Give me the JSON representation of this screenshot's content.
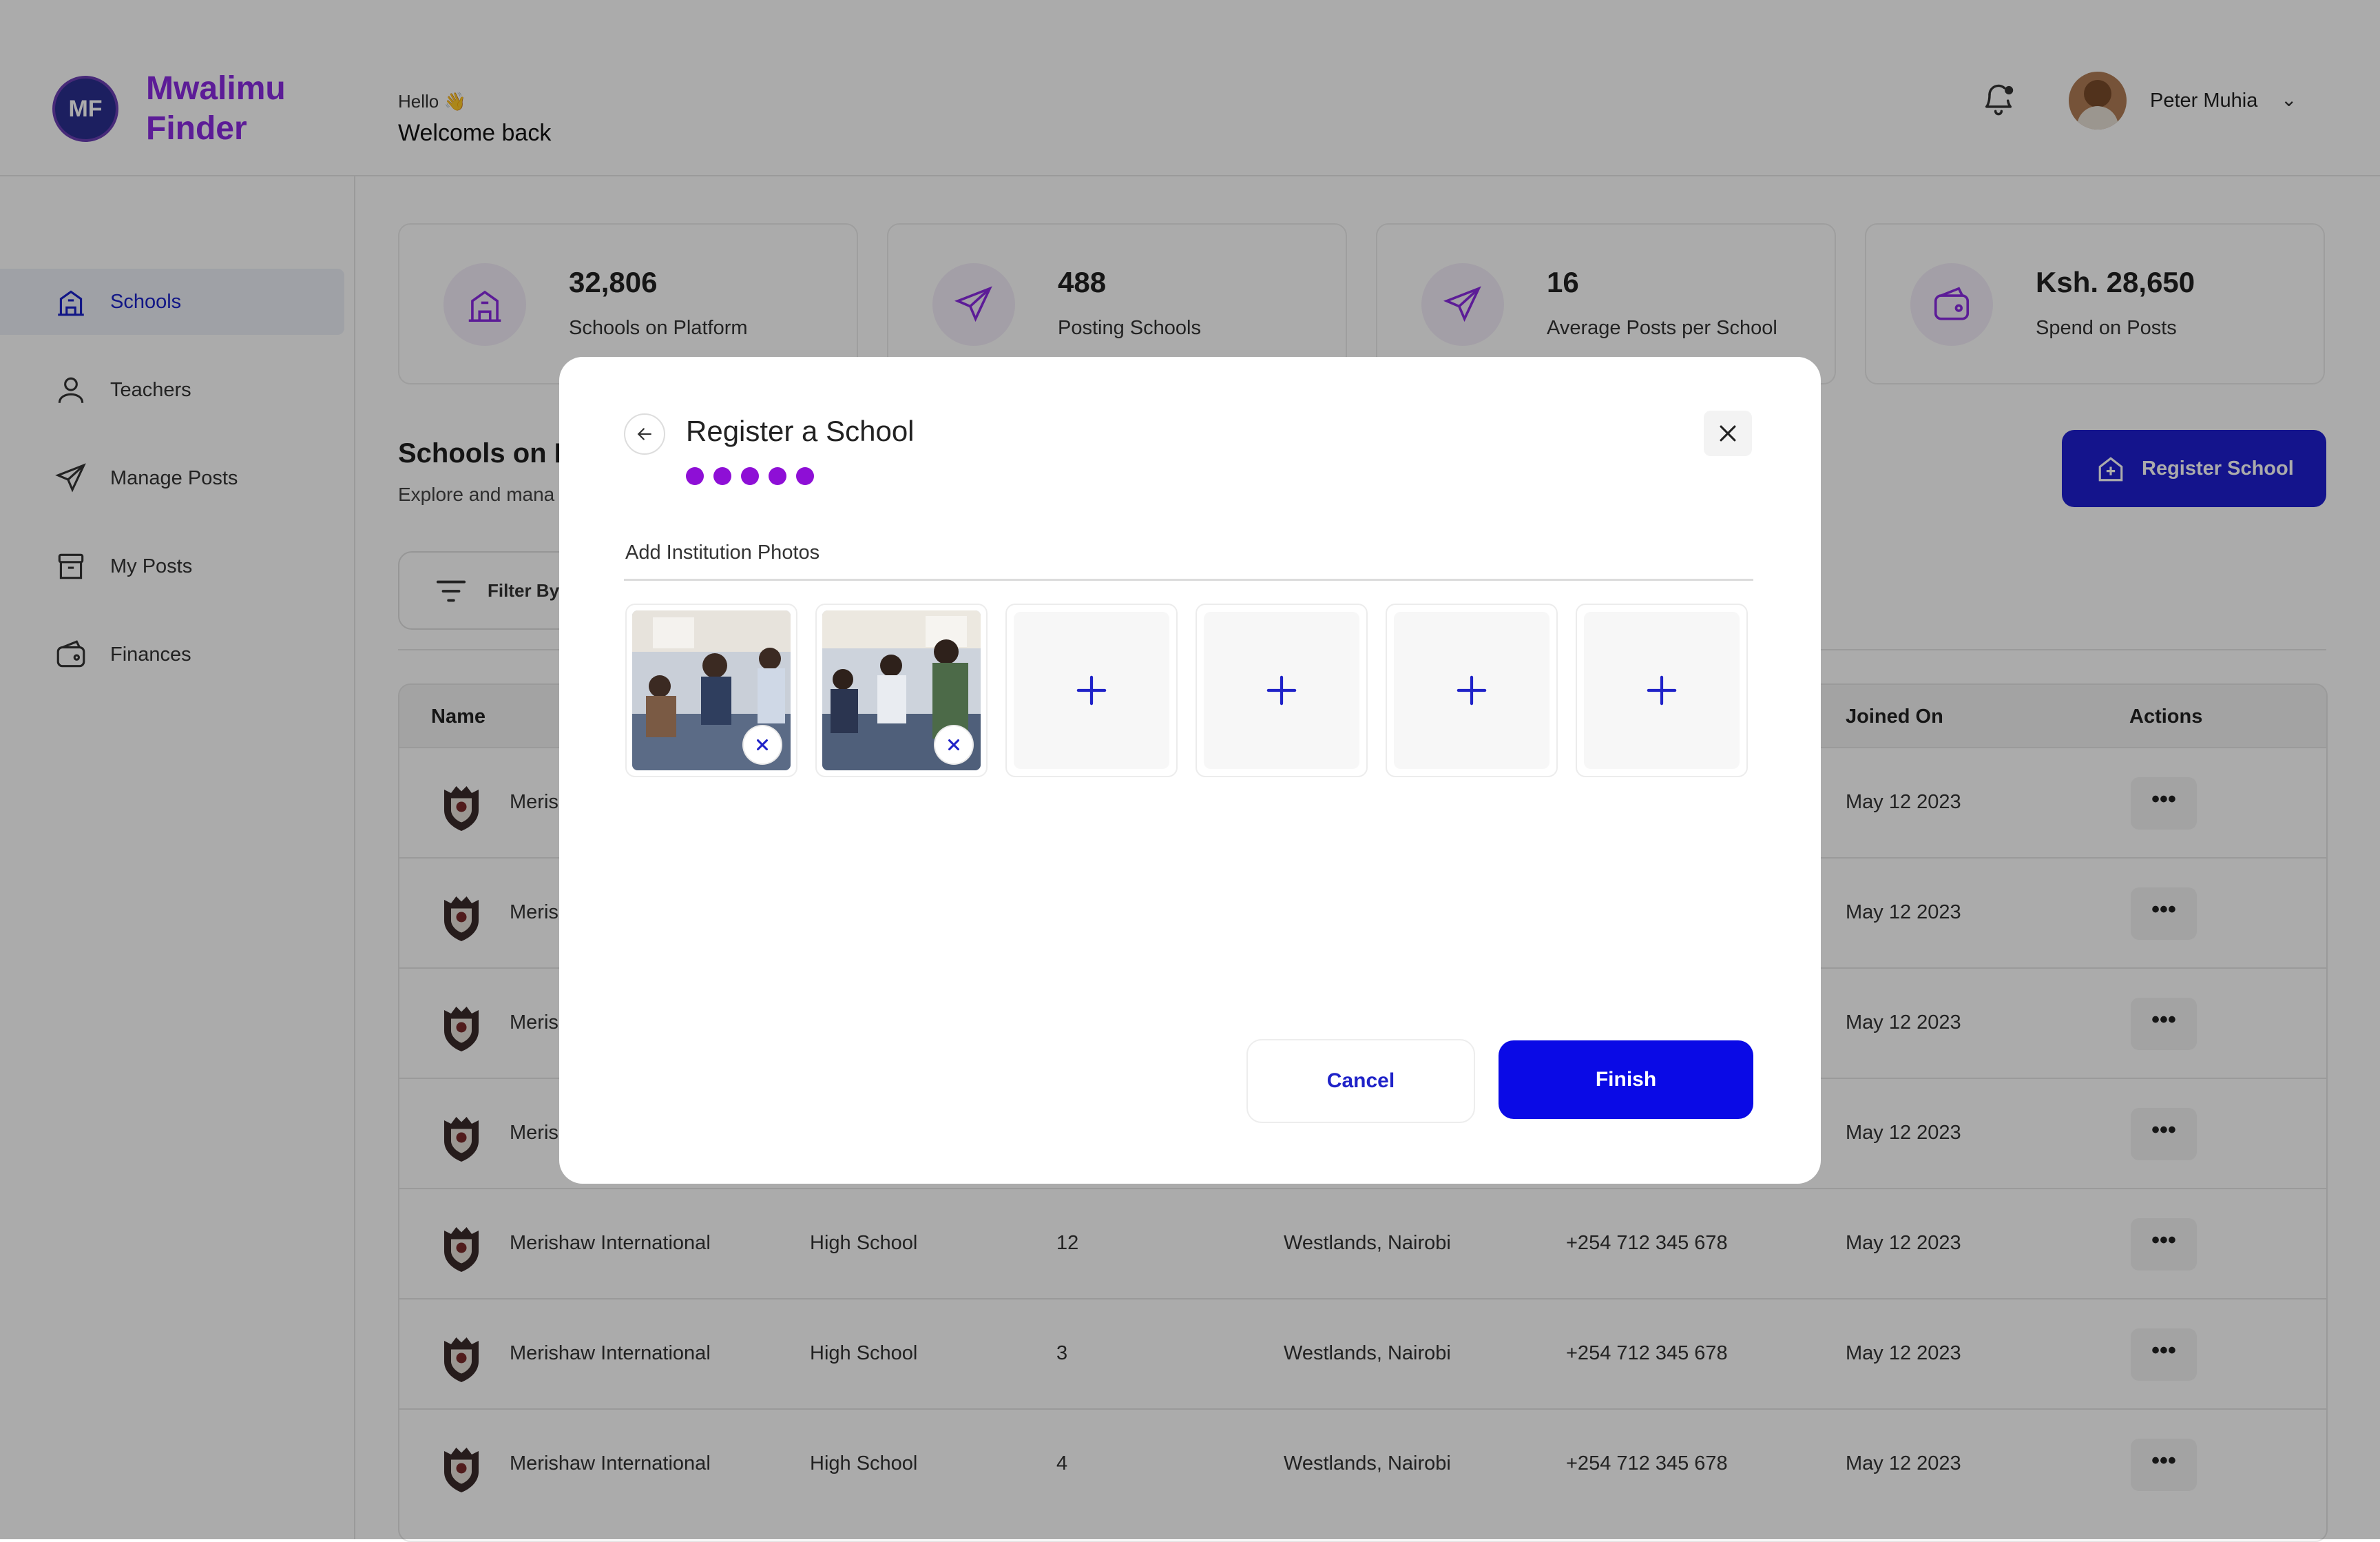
{
  "header": {
    "brand_line1": "Mwalimu",
    "brand_line2": "Finder",
    "greeting": "Hello 👋",
    "welcome": "Welcome back",
    "user_name": "Peter Muhia"
  },
  "sidebar": {
    "items": [
      {
        "label": "Schools",
        "icon": "school-building-icon",
        "active": true
      },
      {
        "label": "Teachers",
        "icon": "user-icon"
      },
      {
        "label": "Manage Posts",
        "icon": "send-icon"
      },
      {
        "label": "My Posts",
        "icon": "archive-icon"
      },
      {
        "label": "Finances",
        "icon": "wallet-icon"
      }
    ]
  },
  "stats": [
    {
      "value": "32,806",
      "label": "Schools on Platform",
      "icon": "school-building-icon"
    },
    {
      "value": "488",
      "label": "Posting Schools",
      "icon": "send-icon"
    },
    {
      "value": "16",
      "label": "Average Posts per School",
      "icon": "send-icon"
    },
    {
      "value": "Ksh. 28,650",
      "label": "Spend on Posts",
      "icon": "wallet-icon"
    }
  ],
  "main": {
    "title": "Schools on P",
    "subtitle": "Explore and mana",
    "filter_label": "Filter By",
    "register_button": "Register School"
  },
  "table": {
    "headers": {
      "name": "Name",
      "joined": "Joined On",
      "actions": "Actions"
    },
    "rows": [
      {
        "name": "Meris",
        "type": "",
        "count": "",
        "location": "",
        "phone": "",
        "joined": "May 12 2023"
      },
      {
        "name": "Meris",
        "type": "",
        "count": "",
        "location": "",
        "phone": "",
        "joined": "May 12 2023"
      },
      {
        "name": "Meris",
        "type": "",
        "count": "",
        "location": "",
        "phone": "",
        "joined": "May 12 2023"
      },
      {
        "name": "Meris",
        "type": "",
        "count": "",
        "location": "",
        "phone": "",
        "joined": "May 12 2023"
      },
      {
        "name": "Merishaw International",
        "type": "High School",
        "count": "12",
        "location": "Westlands, Nairobi",
        "phone": "+254 712 345 678",
        "joined": "May 12 2023"
      },
      {
        "name": "Merishaw International",
        "type": "High School",
        "count": "3",
        "location": "Westlands, Nairobi",
        "phone": "+254 712 345 678",
        "joined": "May 12 2023"
      },
      {
        "name": "Merishaw International",
        "type": "High School",
        "count": "4",
        "location": "Westlands, Nairobi",
        "phone": "+254 712 345 678",
        "joined": "May 12 2023"
      }
    ],
    "actions_glyph": "•••"
  },
  "modal": {
    "title": "Register a School",
    "step_count": 5,
    "section_label": "Add Institution Photos",
    "photos_uploaded": 2,
    "empty_slots": 4,
    "add_glyph": "+",
    "remove_glyph": "×",
    "cancel_label": "Cancel",
    "finish_label": "Finish"
  },
  "colors": {
    "brand_purple": "#8a2be2",
    "primary_blue": "#0a0ae6",
    "nav_active": "#1a22c8",
    "step_dot": "#8e0fd6"
  }
}
